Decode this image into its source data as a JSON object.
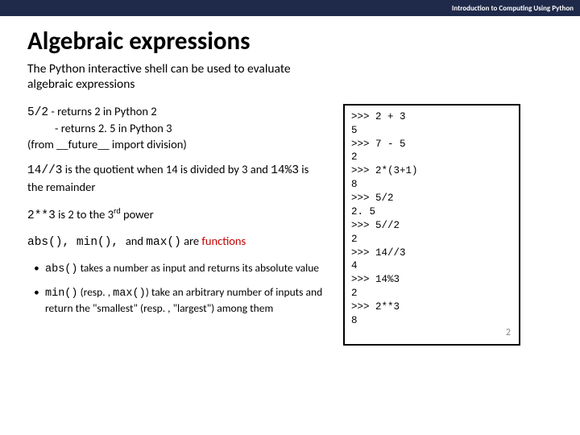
{
  "header": {
    "course": "Introduction to Computing Using Python"
  },
  "title": "Algebraic expressions",
  "subtitle": "The Python interactive shell can be used to evaluate algebraic expressions",
  "body": {
    "div_expr": "5/2",
    "div_line1": " - returns 2 in Python 2",
    "div_line2": "- returns 2. 5 in Python 3",
    "div_line3": "(from __future__ import division)",
    "floordiv_code1": "14//3",
    "floordiv_text1": " is the quotient when 14 is divided by 3 and ",
    "floordiv_code2": "14%3",
    "floordiv_text2": " is the remainder",
    "pow_code": "2**3",
    "pow_text": "  is 2 to the 3",
    "pow_sup": "rd",
    "pow_tail": " power",
    "funcs_codes": "abs(), min(), ",
    "funcs_and": "and ",
    "funcs_max": "max()",
    "funcs_are": " are ",
    "funcs_word": "functions",
    "bullet1_code": "abs()",
    "bullet1_text": " takes a number as input and returns its absolute value",
    "bullet2_code1": "min()",
    "bullet2_mid": " (resp. , ",
    "bullet2_code2": "max()",
    "bullet2_tail": ") take an arbitrary number of inputs and return the \"smallest\" (resp. , \"largest\") among them"
  },
  "shell": {
    "lines": ">>> 2 + 3\n5\n>>> 7 - 5\n2\n>>> 2*(3+1)\n8\n>>> 5/2\n2. 5\n>>> 5//2\n2\n>>> 14//3\n4\n>>> 14%3\n2\n>>> 2**3\n8"
  },
  "page_number": "2"
}
